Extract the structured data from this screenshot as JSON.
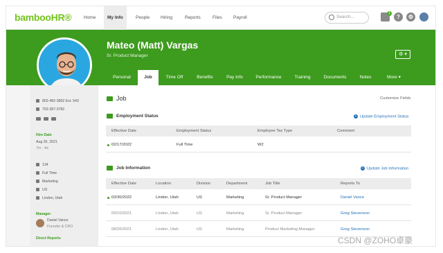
{
  "app": {
    "logo": "bamboo",
    "logo_hr": "HR®"
  },
  "topnav": {
    "items": [
      "Home",
      "My Info",
      "People",
      "Hiring",
      "Reports",
      "Files",
      "Payroll"
    ],
    "active": "My Info",
    "search_placeholder": "Search...",
    "notification_count": "1",
    "icons": [
      "inbox-icon",
      "help-icon",
      "gear-icon",
      "user-avatar"
    ]
  },
  "profile": {
    "name": "Mateo (Matt) Vargas",
    "title": "Sr. Product Manager",
    "settings_button": "⚙ ▾"
  },
  "tabs": [
    "Personal",
    "Job",
    "Time Off",
    "Benefits",
    "Pay Info",
    "Performance",
    "Training",
    "Documents",
    "Notes",
    "More ▾"
  ],
  "active_tab": "Job",
  "sidebar": {
    "phone_work": "802-482-3892",
    "phone_ext": "Ext. 543",
    "phone_mobile": "702-387-3782",
    "hire_date_label": "Hire Date",
    "hire_date": "Aug 26, 2021",
    "hire_duration": "7m - 4d",
    "employee_number": "134",
    "employment_type": "Full Time",
    "department": "Marketing",
    "country": "US",
    "location": "Lindon, Utah",
    "manager_label": "Manager",
    "manager_name": "Daniel Vance",
    "manager_title": "Founder & CRO",
    "direct_reports_label": "Direct Reports"
  },
  "main": {
    "section_title": "Job",
    "customize_link": "Customize Fields",
    "employment_status": {
      "title": "Employment Status",
      "update_link": "Update Employment Status",
      "headers": [
        "Effective Date",
        "Employment Status",
        "Employee Tax Type",
        "Comment"
      ],
      "rows": [
        [
          "02/17/2022",
          "Full Time",
          "W2",
          ""
        ]
      ]
    },
    "job_information": {
      "title": "Job Information",
      "update_link": "Update Job Information",
      "headers": [
        "Effective Date",
        "Location",
        "Division",
        "Department",
        "Job Title",
        "Reports To"
      ],
      "rows": [
        [
          "03/30/2022",
          "Lindon, Utah",
          "US",
          "Marketing",
          "Sr. Product Manager",
          "Daniel Vance"
        ],
        [
          "09/10/2021",
          "Lindon, Utah",
          "US",
          "Marketing",
          "Sr. Product Manager",
          "Greg Stevenson"
        ],
        [
          "08/26/2021",
          "Lindon, Utah",
          "US",
          "Marketing",
          "Product Marketing Manager",
          "Greg Stevenson"
        ]
      ]
    }
  },
  "watermark": "CSDN @ZOHO卓豪",
  "colors": {
    "brand_green": "#3d9b1e",
    "link_blue": "#1f6fb5",
    "logo_green": "#73c41d"
  }
}
